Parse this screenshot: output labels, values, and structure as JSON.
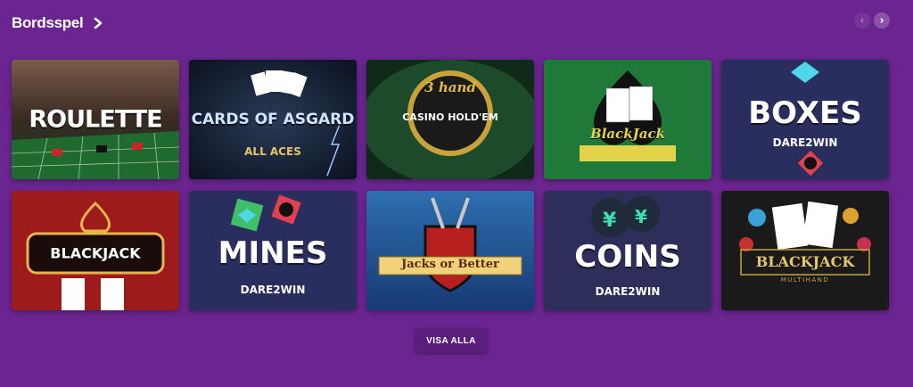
{
  "section": {
    "title": "Bordsspel"
  },
  "games": [
    {
      "title": "ROULETTE",
      "sub": ""
    },
    {
      "title": "CARDS OF ASGARD",
      "sub": "ALL ACES"
    },
    {
      "title": "3 hand",
      "sub": "CASINO HOLD'EM"
    },
    {
      "title": "BlackJack",
      "sub": ""
    },
    {
      "title": "BOXES",
      "sub": "DARE2WIN"
    },
    {
      "title": "BLACKJACK",
      "sub": ""
    },
    {
      "title": "MINES",
      "sub": "DARE2WIN"
    },
    {
      "title": "Jacks or Better",
      "sub": ""
    },
    {
      "title": "COINS",
      "sub": "DARE2WIN"
    },
    {
      "title": "BLACKJACK",
      "sub": "MULTIHAND"
    }
  ],
  "show_all_label": "VISA ALLA",
  "colors": {
    "background": "#6b2590",
    "button": "#5a1e7c"
  }
}
